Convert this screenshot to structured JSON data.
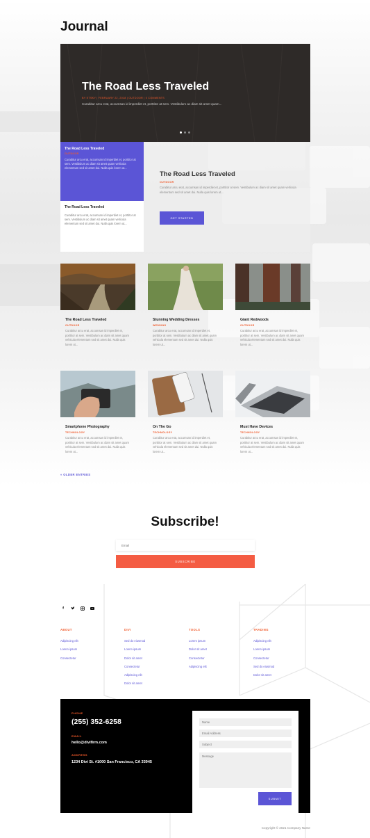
{
  "page": {
    "title": "Journal"
  },
  "hero": {
    "title": "The Road Less Traveled",
    "meta": "BY ETSKY | FEBRUARY 22, 2018 | OUTDOOR | 0 COMMENTS",
    "excerpt": "Curabitur arcu erat, accumsan id imperdiet et, porttitor at sem. Vestibulum ac diam sit amet quam..."
  },
  "tabs": [
    {
      "title": "The Road Less Traveled",
      "category": "OUTDOOR",
      "excerpt": "Curabitur arcu erat, accumsan id imperdiet et, porttitor at sem. Vestibulum ac diam sit amet quam vehicula elementum sed sit amet dui. Nulla quis lorem ut..."
    },
    {
      "title": "The Road Less Traveled",
      "category": "",
      "excerpt": "Curabitur arcu erat, accumsan id imperdiet et, porttitor at sem. Vestibulum ac diam sit amet quam vehicula elementum sed sit amet dui. Nulla quis lorem ut..."
    }
  ],
  "featured": {
    "title": "The Road Less Traveled",
    "category": "OUTDOOR",
    "excerpt": "Curabitur arcu erat, accumsan id imperdiet et, porttitor at sem. Vestibulum ac diam sit amet quam vehicula elementum sed sit amet dui. Nulla quis lorem ut...",
    "button": "GET STARTED"
  },
  "posts": [
    {
      "title": "The Road Less Traveled",
      "category": "OUTDOOR",
      "excerpt": "Curabitur arcu erat, accumsan id imperdiet et, porttitor at sem. Vestibulum ac diam sit amet quam vehicula elementum sed sit amet dui. Nulla quis lorem ut..."
    },
    {
      "title": "Stunning Wedding Dresses",
      "category": "WEDDING",
      "excerpt": "Curabitur arcu erat, accumsan id imperdiet et, porttitor at sem. Vestibulum ac diam sit amet quam vehicula elementum sed sit amet dui. Nulla quis lorem ut..."
    },
    {
      "title": "Giant Redwoods",
      "category": "OUTDOOR",
      "excerpt": "Curabitur arcu erat, accumsan id imperdiet et, porttitor at sem. Vestibulum ac diam sit amet quam vehicula elementum sed sit amet dui. Nulla quis lorem ut..."
    },
    {
      "title": "Smartphone Photography",
      "category": "TECHNOLOGY",
      "excerpt": "Curabitur arcu erat, accumsan id imperdiet et, porttitor at sem. Vestibulum ac diam sit amet quam vehicula elementum sed sit amet dui. Nulla quis lorem ut..."
    },
    {
      "title": "On The Go",
      "category": "TECHNOLOGY",
      "excerpt": "Curabitur arcu erat, accumsan id imperdiet et, porttitor at sem. Vestibulum ac diam sit amet quam vehicula elementum sed sit amet dui. Nulla quis lorem ut..."
    },
    {
      "title": "Must Have Devices",
      "category": "TECHNOLOGY",
      "excerpt": "Curabitur arcu erat, accumsan id imperdiet et, porttitor at sem. Vestibulum ac diam sit amet quam vehicula elementum sed sit amet dui. Nulla quis lorem ut..."
    }
  ],
  "pagination": {
    "older": "« OLDER ENTRIES"
  },
  "subscribe": {
    "title": "Subscribe!",
    "placeholder": "Email",
    "button": "SUBSCRIBE"
  },
  "social": [
    "facebook-icon",
    "twitter-icon",
    "instagram-icon",
    "youtube-icon"
  ],
  "footer_columns": [
    {
      "title": "ABOUT",
      "links": [
        "Adipiscing elit",
        "Lorem ipsum",
        "Consectetur"
      ]
    },
    {
      "title": "DIVI",
      "links": [
        "Sed do eiusmod",
        "Lorem ipsum",
        "Dolor sit amet",
        "Consectetur",
        "Adipiscing elit",
        "Dolor sit amet"
      ]
    },
    {
      "title": "TOOLS",
      "links": [
        "Lorem ipsum",
        "Dolor sit amet",
        "Consectetur",
        "Adipiscing elit"
      ]
    },
    {
      "title": "TRADING",
      "links": [
        "Adipiscing elit",
        "Lorem ipsum",
        "Consectetur",
        "Sed do eiusmod",
        "Dolor sit amet"
      ]
    }
  ],
  "contact": {
    "phone_label": "PHONE",
    "phone": "(255) 352-6258",
    "email_label": "EMAIL",
    "email": "hello@divifirm.com",
    "address_label": "ADDRESS",
    "address": "1234 Divi St. #1000 San Francisco, CA 33945"
  },
  "form": {
    "name": "Name",
    "email": "Email Address",
    "subject": "Subject",
    "message": "Message",
    "submit": "SUBMIT"
  },
  "copyright": "Copyright © 2021 Company Name",
  "colors": {
    "accent": "#5b55d6",
    "orange": "#f0592a",
    "coral": "#f45c43",
    "dark": "#000000"
  }
}
